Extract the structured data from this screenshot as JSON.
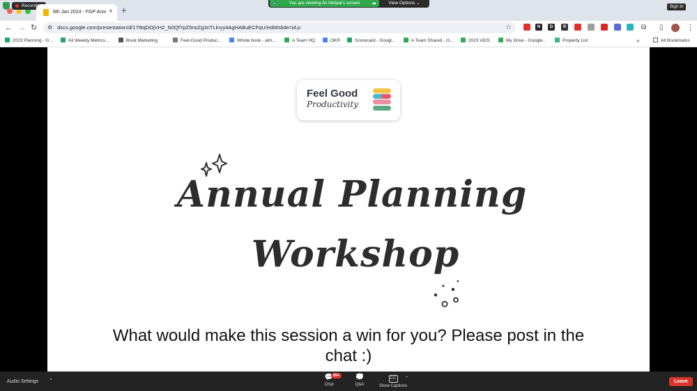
{
  "recording": {
    "label": "Recording"
  },
  "tab": {
    "title": "6th Jan 2024 - FGP Annual P",
    "close_icon": "×"
  },
  "new_tab_icon": "+",
  "share_banner": {
    "text": "You are viewing Ali Abdaal's screen",
    "view_options": "View Options"
  },
  "sign_in": "Sign in",
  "nav": {
    "back_icon": "←",
    "forward_icon": "→",
    "reload_icon": "↻"
  },
  "address_bar": {
    "url": "docs.google.com/presentation/d/17l9qDOjVH2_N0QfYpZ5noZg3nTLkryy4AgHABuECFqU/edit#slide=id.p"
  },
  "extensions": [
    {
      "icon": "pdf-icon",
      "glyph": "",
      "color": "#e0332f"
    },
    {
      "icon": "notion-icon",
      "glyph": "N",
      "color": "#222222"
    },
    {
      "icon": "readwise-icon",
      "glyph": "D",
      "color": "#2a2a2a"
    },
    {
      "icon": "roam-icon",
      "glyph": "R",
      "color": "#333333"
    },
    {
      "icon": "youtube-icon",
      "glyph": "",
      "color": "#e0332f"
    },
    {
      "icon": "screen-icon",
      "glyph": "",
      "color": "#9e9e9e"
    },
    {
      "icon": "pinterest-icon",
      "glyph": "",
      "color": "#d62a2a"
    },
    {
      "icon": "gear-ext-icon",
      "glyph": "",
      "color": "#5b6ad6"
    },
    {
      "icon": "grammarly-icon",
      "glyph": "",
      "color": "#2bb3c0"
    }
  ],
  "bookmarks": [
    {
      "label": "2023 Planning - G...",
      "icon": "sheets-icon",
      "color": "#1fa463"
    },
    {
      "label": "Ali Weekly Metrics...",
      "icon": "sheets-icon",
      "color": "#1fa463"
    },
    {
      "label": "Book Marketing",
      "icon": "folder-icon",
      "color": "#555555"
    },
    {
      "label": "Feel-Good Produc...",
      "icon": "globe-icon",
      "color": "#777777"
    },
    {
      "label": "Whole book - alm...",
      "icon": "docs-icon",
      "color": "#4285f4"
    },
    {
      "label": "A Team HQ",
      "icon": "drive-icon",
      "color": "#34a853"
    },
    {
      "label": "OKR",
      "icon": "google-icon",
      "color": "#4285f4"
    },
    {
      "label": "Scorecard - Googl...",
      "icon": "sheets-icon",
      "color": "#1fa463"
    },
    {
      "label": "A Team Shared - G...",
      "icon": "drive-icon",
      "color": "#34a853"
    },
    {
      "label": "2023 ViDS",
      "icon": "drive-icon",
      "color": "#34a853"
    },
    {
      "label": "My Drive - Google...",
      "icon": "drive-icon",
      "color": "#34a853"
    },
    {
      "label": "Property List",
      "icon": "cloud-icon",
      "color": "#3fb37f"
    }
  ],
  "all_bookmarks": "All Bookmarks",
  "slide": {
    "logo_line1": "Feel Good",
    "logo_line2": "Productivity",
    "title_line1": "Annual Planning",
    "title_line2": "Workshop",
    "question": "What would make this session a win for you? Please post in the chat :)",
    "logo_colors": [
      "#f5c342",
      "#4fb8c9",
      "#e9556a",
      "#e98fa0",
      "#5aa783"
    ]
  },
  "zoom_controls": {
    "audio_settings": "Audio Settings",
    "chat": "Chat",
    "chat_badge": "99+",
    "qa": "Q&A",
    "show_captions": "Show Captions",
    "cc": "CC",
    "leave": "Leave"
  }
}
